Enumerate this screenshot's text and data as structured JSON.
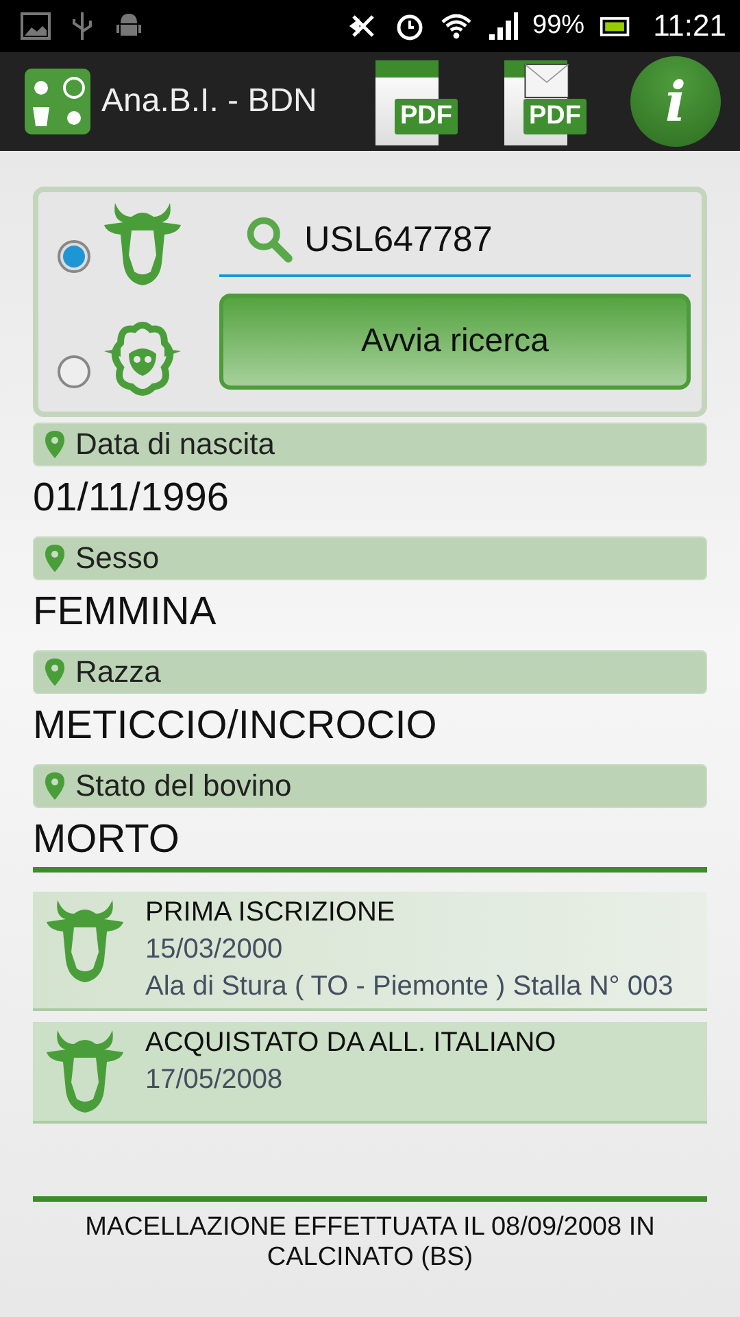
{
  "status_bar": {
    "battery": "99%",
    "time": "11:21"
  },
  "app_bar": {
    "title": "Ana.B.I. - BDN",
    "actions": [
      {
        "kind": "pdf",
        "label": "PDF"
      },
      {
        "kind": "mail_pdf",
        "label": "PDF"
      },
      {
        "kind": "info",
        "label": "i"
      }
    ]
  },
  "search": {
    "species": [
      {
        "kind": "cattle",
        "selected": true
      },
      {
        "kind": "sheep",
        "selected": false
      }
    ],
    "query": "USL647787",
    "button": "Avvia ricerca"
  },
  "fields": [
    {
      "label": "Data di nascita",
      "value": "01/11/1996"
    },
    {
      "label": "Sesso",
      "value": "FEMMINA"
    },
    {
      "label": "Razza",
      "value": "METICCIO/INCROCIO"
    },
    {
      "label": "Stato del bovino",
      "value": "MORTO"
    }
  ],
  "events": [
    {
      "title": "PRIMA ISCRIZIONE",
      "date": "15/03/2000",
      "place": "Ala di Stura ( TO - Piemonte ) Stalla N° 003"
    },
    {
      "title": "ACQUISTATO DA ALL. ITALIANO",
      "date": "17/05/2008"
    }
  ],
  "footer": "MACELLAZIONE EFFETTUATA IL 08/09/2008 IN CALCINATO (BS)"
}
